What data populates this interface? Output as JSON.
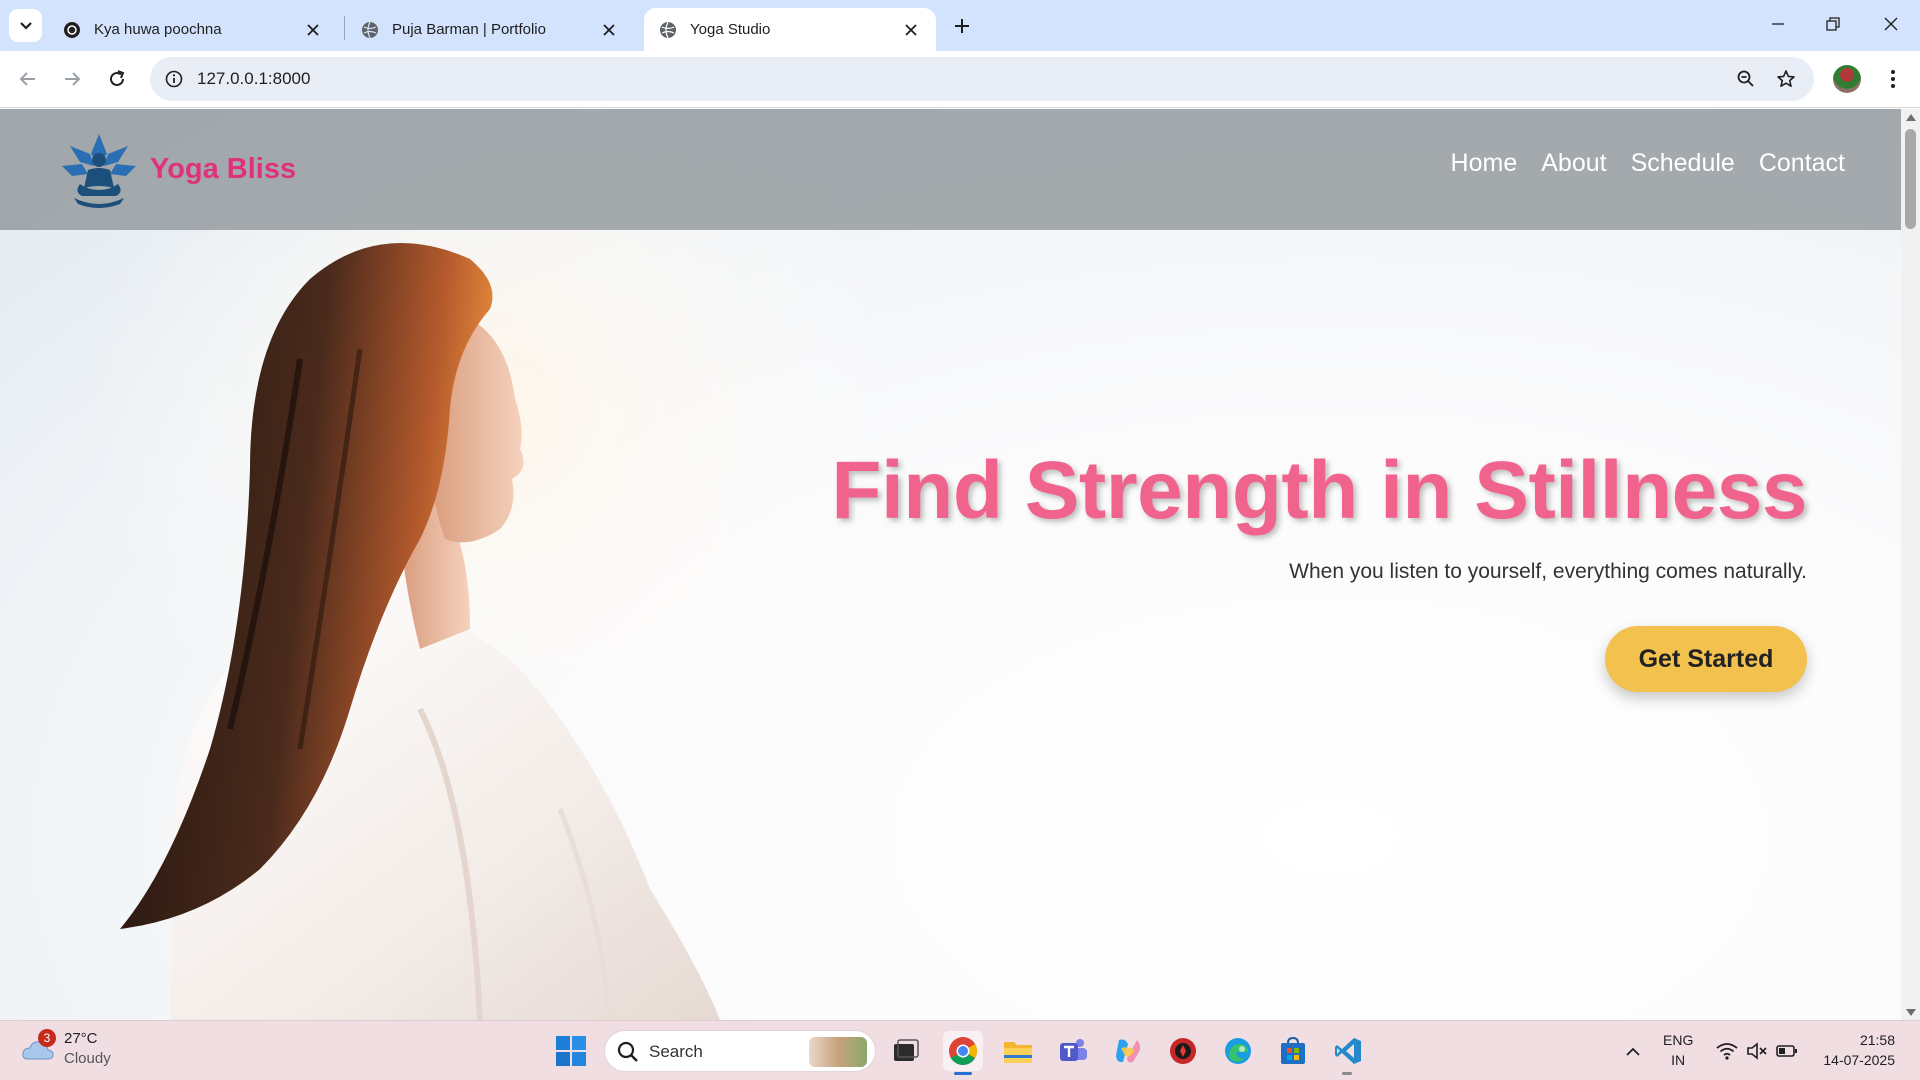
{
  "browser": {
    "tabs": [
      {
        "title": "Kya huwa poochna",
        "favicon": "openai-icon",
        "active": false
      },
      {
        "title": "Puja Barman | Portfolio",
        "favicon": "globe-icon",
        "active": false
      },
      {
        "title": "Yoga Studio",
        "favicon": "globe-icon",
        "active": true
      }
    ],
    "url": "127.0.0.1:8000"
  },
  "site": {
    "brand": "Yoga Bliss",
    "logo_icon": "meditation-lotus-icon",
    "nav": [
      "Home",
      "About",
      "Schedule",
      "Contact"
    ],
    "hero": {
      "title": "Find Strength in Stillness",
      "subtitle": "When you listen to yourself, everything comes naturally.",
      "cta": "Get Started"
    }
  },
  "taskbar": {
    "weather": {
      "temp": "27°C",
      "condition": "Cloudy",
      "badge": "3"
    },
    "search_placeholder": "Search",
    "language": {
      "line1": "ENG",
      "line2": "IN"
    },
    "time": "21:58",
    "date": "14-07-2025"
  },
  "colors": {
    "brand": "#e0327c",
    "hero_title": "#f0638d",
    "cta": "#f2c14e",
    "header_bg": "#969ca0",
    "tabbar": "#d3e3fd"
  }
}
